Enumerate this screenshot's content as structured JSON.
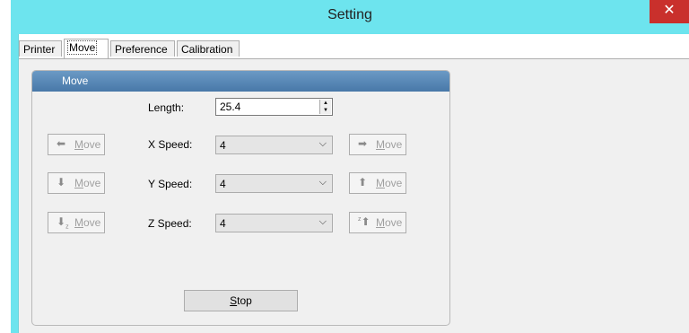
{
  "window": {
    "title": "Setting",
    "close_symbol": "✕"
  },
  "tabs": [
    {
      "label": "Printer"
    },
    {
      "label": "Move",
      "active": true
    },
    {
      "label": "Preference"
    },
    {
      "label": "Calibration"
    }
  ],
  "move_group": {
    "header": "Move",
    "length_label": "Length:",
    "length_value": "25.4",
    "x_speed_label": "X Speed:",
    "x_speed_value": "4",
    "y_speed_label": "Y Speed:",
    "y_speed_value": "4",
    "z_speed_label": "Z Speed:",
    "z_speed_value": "4",
    "move_label": "Move",
    "move_mnemonic": "M",
    "move_rest": "ove",
    "stop_label": "Stop",
    "stop_mnemonic": "S",
    "stop_rest": "top"
  },
  "icons": {
    "x_minus": "arrow-left-icon",
    "x_plus": "arrow-right-icon",
    "y_minus": "arrow-down-icon",
    "y_plus": "arrow-up-icon",
    "z_minus": "z-down-icon",
    "z_plus": "z-up-icon",
    "dropdown": "chevron-down-icon"
  },
  "colors": {
    "titlebar": "#6de4ee",
    "close_button": "#c9302c",
    "group_header_top": "#6b9ac5",
    "group_header_bottom": "#4878a8",
    "disabled_text": "#a0a0a0"
  }
}
